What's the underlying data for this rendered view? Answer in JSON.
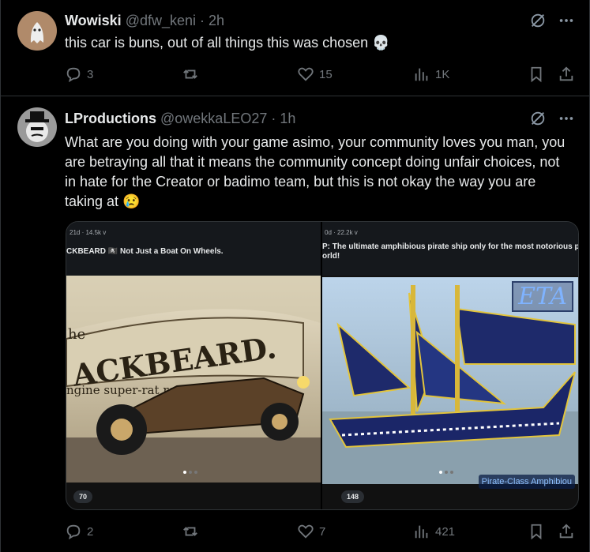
{
  "post1": {
    "name": "Wowiski",
    "handle": "@dfw_keni",
    "time": "· 2h",
    "text": "this car is buns, out of all things this was chosen",
    "emoji": "💀",
    "replies": "3",
    "reposts": "",
    "likes": "15",
    "views": "1K"
  },
  "post2": {
    "name": "LProductions",
    "handle": "@owekkaLEO27",
    "time": "· 1h",
    "text": "What are you doing with your game asimo, your community loves you man, you are betraying all that it means the community concept doing unfair choices, not in hate for the Creator or badimo team, but this is not okay the way you are taking at",
    "emoji": "😢",
    "replies": "2",
    "reposts": "",
    "likes": "7",
    "views": "421",
    "media": {
      "left": {
        "meta": "21d · 14.5k v",
        "caption": "CKBEARD 🏴‍☠️ Not Just a Boat On Wheels.",
        "sign_word": "ACKBEARD.",
        "sign_prefix": "he",
        "sign_sub": "ngine super-rat rod.",
        "badge": "70"
      },
      "right": {
        "meta": "0d · 22.2k v",
        "caption": "P: The ultimate amphibious pirate ship only for the most notorious pirate",
        "caption2": "orld!",
        "logo": "ETA",
        "label": "Pirate-Class Amphibiou",
        "badge": "148"
      }
    }
  }
}
